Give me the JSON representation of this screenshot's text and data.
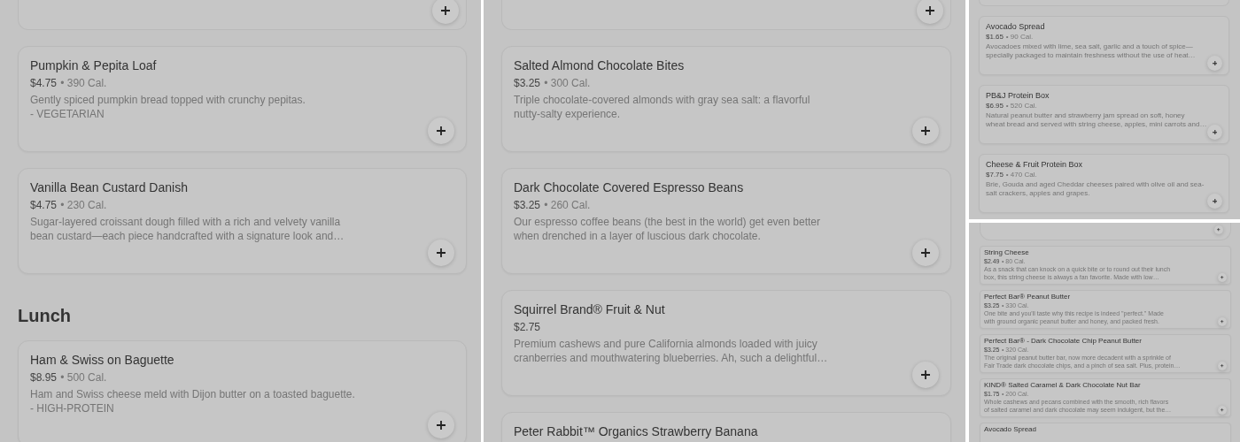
{
  "panels": [
    {
      "kind": "large",
      "items": [
        {
          "kind": "cut_card"
        },
        {
          "kind": "card",
          "title": "Pumpkin & Pepita Loaf",
          "price": "$4.75",
          "calories": "• 390 Cal.",
          "description": [
            "Gently spiced pumpkin bread topped with crunchy pepitas."
          ],
          "tag": "- VEGETARIAN"
        },
        {
          "kind": "card",
          "title": "Vanilla Bean Custard Danish",
          "price": "$4.75",
          "calories": "• 230 Cal.",
          "description": [
            "Sugar-layered croissant dough filled with a rich and velvety vanilla",
            "bean custard—each piece handcrafted with a signature look and…"
          ]
        },
        {
          "kind": "heading",
          "title": "Lunch"
        },
        {
          "kind": "card",
          "title": "Ham & Swiss on Baguette",
          "price": "$8.95",
          "calories": "• 500 Cal.",
          "description": [
            "Ham and Swiss cheese meld with Dijon butter on a toasted baguette."
          ],
          "tag": "- HIGH-PROTEIN"
        }
      ]
    },
    {
      "kind": "large",
      "items": [
        {
          "kind": "cut_card"
        },
        {
          "kind": "card",
          "title": "Salted Almond Chocolate Bites",
          "price": "$3.25",
          "calories": "• 300 Cal.",
          "description": [
            "Triple chocolate-covered almonds with gray sea salt: a flavorful",
            "nutty-salty experience."
          ]
        },
        {
          "kind": "card",
          "title": "Dark Chocolate Covered Espresso Beans",
          "price": "$3.25",
          "calories": "• 260 Cal.",
          "description": [
            "Our espresso coffee beans (the best in the world) get even better",
            "when drenched in a layer of luscious dark chocolate."
          ]
        },
        {
          "kind": "card",
          "title": "Squirrel Brand® Fruit & Nut",
          "price": "$2.75",
          "description": [
            "Premium cashews and pure California almonds loaded with juicy",
            "cranberries and mouthwatering blueberries. Ah, such a delightful…"
          ]
        },
        {
          "kind": "card",
          "title": "Peter Rabbit™ Organics Strawberry Banana"
        }
      ]
    },
    {
      "kind": "medium",
      "items": [
        {
          "kind": "cut_card"
        },
        {
          "kind": "card",
          "title": "Avocado Spread",
          "price": "$1.65",
          "calories": "• 90 Cal.",
          "description": [
            "Avocadoes mixed with lime, sea salt, garlic and a touch of spice—",
            "specially packaged to maintain freshness without the use of heat…"
          ]
        },
        {
          "kind": "card",
          "title": "PB&J Protein Box",
          "price": "$6.95",
          "calories": "• 520 Cal.",
          "description": [
            "Natural peanut butter and strawberry jam spread on soft, honey",
            "wheat bread and served with string cheese, apples, mini carrots and…"
          ]
        },
        {
          "kind": "card",
          "title": "Cheese & Fruit Protein Box",
          "price": "$7.75",
          "calories": "• 470 Cal.",
          "description": [
            "Brie, Gouda and aged Cheddar cheeses paired with olive oil and sea-",
            "salt crackers, apples and grapes."
          ]
        }
      ]
    },
    {
      "kind": "small",
      "items": [
        {
          "kind": "cut_card"
        },
        {
          "kind": "card",
          "title": "String Cheese",
          "price": "$2.49",
          "calories": "• 80 Cal.",
          "description": [
            "As a snack that can knock on a quick bite or to round out their lunch",
            "box, this string cheese is always a fan favorite. Made with low…"
          ]
        },
        {
          "kind": "card",
          "title": "Perfect Bar® Peanut Butter",
          "price": "$3.25",
          "calories": "• 330 Cal.",
          "description": [
            "One bite and you'll taste why this recipe is indeed \"perfect.\" Made",
            "with ground organic peanut butter and honey, and packed fresh."
          ]
        },
        {
          "kind": "card",
          "title": "Perfect Bar® - Dark Chocolate Chip Peanut Butter",
          "price": "$3.25",
          "calories": "• 320 Cal.",
          "description": [
            "The original peanut butter bar, now more decadent with a sprinkle of",
            "Fair Trade dark chocolate chips, and a pinch of sea salt. Plus, protein…"
          ]
        },
        {
          "kind": "card",
          "title": "KIND® Salted Caramel & Dark Chocolate Nut Bar",
          "price": "$1.75",
          "calories": "• 200 Cal.",
          "description": [
            "Whole cashews and pecans combined with the smooth, rich flavors",
            "of salted caramel and dark chocolate may seem indulgent, but the…"
          ]
        },
        {
          "kind": "card",
          "title": "Avocado Spread"
        }
      ]
    }
  ]
}
